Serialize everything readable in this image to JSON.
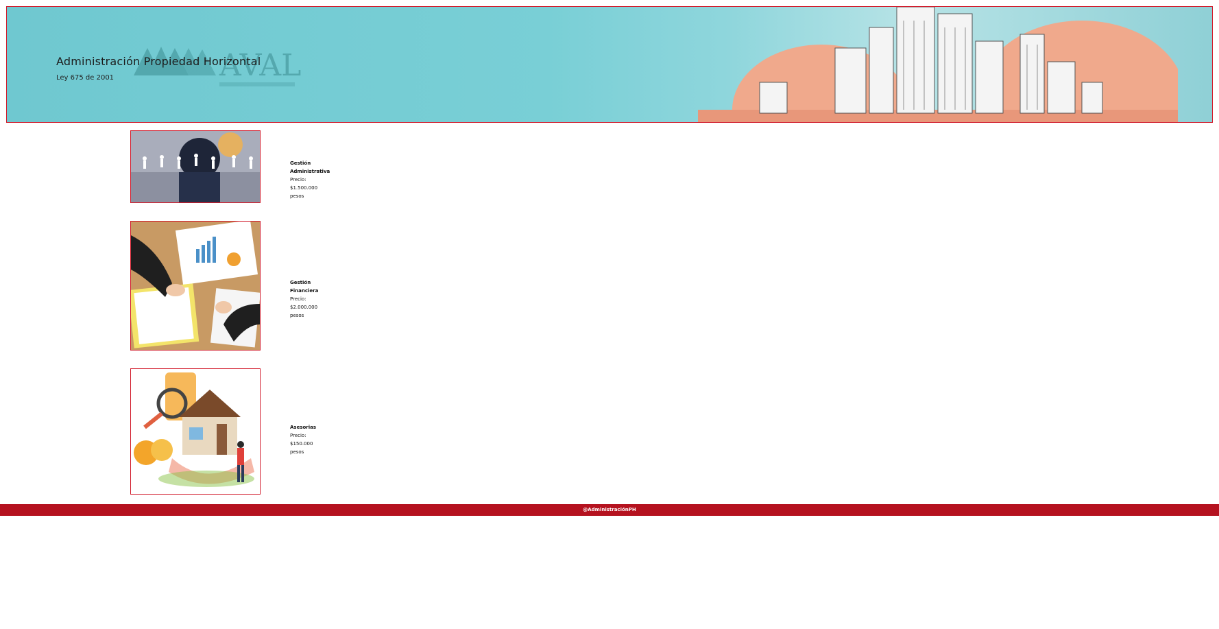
{
  "header": {
    "title": "Administración Propiedad Horizontal",
    "subtitle": "Ley 675 de 2001",
    "logo_text": "AVAL"
  },
  "services": [
    {
      "name": "Gestión Administrativa",
      "price": "Precio: $1.500.000 pesos",
      "image": "business-network-image"
    },
    {
      "name": "Gestión Financiera",
      "price": "Precio: $2.000.000 pesos",
      "image": "financial-charts-image"
    },
    {
      "name": "Asesorias",
      "price": "Precio: $150.000 pesos",
      "image": "house-in-hand-image"
    }
  ],
  "footer": {
    "text": "@AdministraciónPH"
  },
  "colors": {
    "accent": "#b5121f",
    "border": "#d11a2a",
    "banner": "#79cfd6"
  }
}
